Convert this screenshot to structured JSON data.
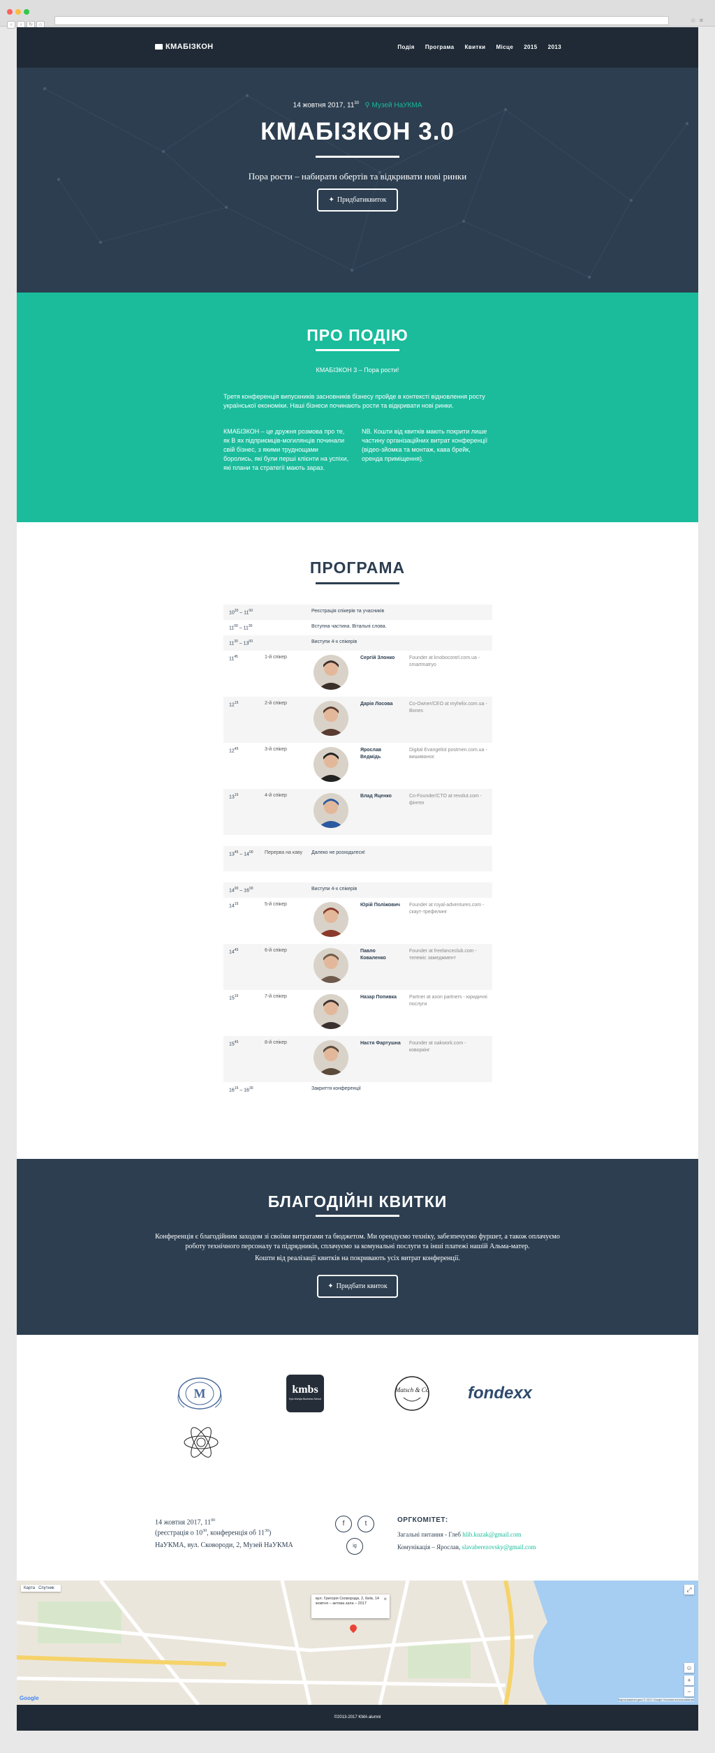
{
  "nav": {
    "brand": "КМАБІЗКОН",
    "links": [
      "Подія",
      "Програма",
      "Квитки",
      "Місце",
      "2015",
      "2013"
    ]
  },
  "hero": {
    "date": "14 жовтня 2017, 11",
    "date_sup": "30",
    "location": "Музей НаУКМА",
    "title": "КМАБІЗКОН 3.0",
    "subtitle": "Пора рости – набирати обертів та відкривати нові ринки",
    "button": "Придбатиквиток"
  },
  "about": {
    "title": "ПРО ПОДІЮ",
    "lead": "КМАБІЗКОН 3 – Пора рости!",
    "p1": "Третя конференція випускників засновників бізнесу пройде в контексті відновлення росту української економіки. Наші бізнеси починають рости та відкривати нові ринки.",
    "col1": "КМАБІЗКОН – це дружня розмова про те, як В ях підприємців-могилянців починали свій бізнес, з якими труднощами боролись, які були перші клієнти на успіхи, які плани та стратегії мають зараз.",
    "col2": "NB. Кошти від квитків мають покрити лише частину організаційних витрат конференції (відео-зйомка та монтаж, кава брейк, оренда приміщення)."
  },
  "program": {
    "title": "ПРОГРАМА",
    "rows": [
      {
        "time": "10",
        "tsup": "30",
        "time2": " – 11",
        "tsup2": "00",
        "slot": "",
        "event": "Реєстрація спікерів та учасників",
        "name": "",
        "role": "",
        "shade": true,
        "photo": false
      },
      {
        "time": "11",
        "tsup": "00",
        "time2": " – 11",
        "tsup2": "30",
        "slot": "",
        "event": "Вступна частина. Вітальні слова.",
        "name": "",
        "role": "",
        "shade": false,
        "photo": false
      },
      {
        "time": "11",
        "tsup": "30",
        "time2": " – 13",
        "tsup2": "00",
        "slot": "",
        "event": "Виступи 4-х спікерів",
        "name": "",
        "role": "",
        "shade": true,
        "photo": false
      },
      {
        "time": "11",
        "tsup": "45",
        "time2": "",
        "tsup2": "",
        "slot": "1-й спікер",
        "event": "",
        "name": "Сергій Злонко",
        "role": "Founder at knobocontrl.com.ua - smartmatryo",
        "shade": false,
        "photo": true
      },
      {
        "time": "12",
        "tsup": "15",
        "time2": "",
        "tsup2": "",
        "slot": "2-й спікер",
        "event": "",
        "name": "Дарія Лосова",
        "role": "Co-Owner/CEO at myhelix.com.ua - Bones",
        "shade": true,
        "photo": true
      },
      {
        "time": "12",
        "tsup": "45",
        "time2": "",
        "tsup2": "",
        "slot": "3-й спікер",
        "event": "",
        "name": "Ярослав Ведмідь",
        "role": "Digital Evangelist postmen.com.ua - вишиваноє",
        "shade": false,
        "photo": true
      },
      {
        "time": "13",
        "tsup": "15",
        "time2": "",
        "tsup2": "",
        "slot": "4-й спікер",
        "event": "",
        "name": "Влад Яценко",
        "role": "Co-Founder/CTO at revolut.com - фінтех",
        "shade": true,
        "photo": true
      },
      {
        "time": "13",
        "tsup": "45",
        "time2": " – 14",
        "tsup2": "00",
        "slot": "Перерва на каву",
        "event": "Далеко не розходьтеся!",
        "name": "",
        "role": "",
        "shade": true,
        "photo": false
      },
      {
        "time": "14",
        "tsup": "00",
        "time2": " – 16",
        "tsup2": "00",
        "slot": "",
        "event": "Виступи 4-х спікерів",
        "name": "",
        "role": "",
        "shade": true,
        "photo": false
      },
      {
        "time": "14",
        "tsup": "15",
        "time2": "",
        "tsup2": "",
        "slot": "5-й спікер",
        "event": "",
        "name": "Юрій Поліжович",
        "role": "Founder at royal-adventures.com - скаут-трефелинг",
        "shade": false,
        "photo": true
      },
      {
        "time": "14",
        "tsup": "45",
        "time2": "",
        "tsup2": "",
        "slot": "6-й спікер",
        "event": "",
        "name": "Павло Коваленко",
        "role": "Founder at freelanceclub.com - телеміс замеджмент",
        "shade": true,
        "photo": true
      },
      {
        "time": "15",
        "tsup": "15",
        "time2": "",
        "tsup2": "",
        "slot": "7-й спікер",
        "event": "",
        "name": "Назар Попивка",
        "role": "Partner at axon partners - юридичні послуги",
        "shade": false,
        "photo": true
      },
      {
        "time": "15",
        "tsup": "45",
        "time2": "",
        "tsup2": "",
        "slot": "8-й спікер",
        "event": "",
        "name": "Настя Фартушна",
        "role": "Founder at oakwork.com - коворкінг",
        "shade": true,
        "photo": true
      },
      {
        "time": "16",
        "tsup": "15",
        "time2": " – 16",
        "tsup2": "30",
        "slot": "",
        "event": "Закриття конференції",
        "name": "",
        "role": "",
        "shade": false,
        "photo": false
      }
    ]
  },
  "charity": {
    "title": "БЛАГОДІЙНІ КВИТКИ",
    "text": "Конференція є благодійним заходом зі своїми витратами та бюджетом. Ми орендуємо техніку, забезпечуємо фуршет, а також оплачуємо роботу технічного персоналу та підрядників, сплачуємо за комунальні послуги та інші платежі нашій Альма-матер.",
    "text2": "Кошти від реалізації квитків на покривають усіх витрат конференції.",
    "button": "Придбати квиток"
  },
  "sponsors": {
    "kmbs_label": "kmbs",
    "kmbs_small": "Kyiv-Mohyla Business School",
    "matsch": "Matsch & Co",
    "fondexx": "fondexx"
  },
  "footer": {
    "line1": "14 жовтня 2017, 11",
    "line1_sup": "00",
    "line2a": "(реєстрація о 10",
    "line2_sup": "30",
    "line2b": ", конференція об 11",
    "line2_sup2": "30",
    "line2c": ")",
    "address": "НаУКМА, вул. Сковороди, 2, Музей НаУКМА",
    "org_title": "ОРГКОМІТЕТ:",
    "org1_label": "Загальні питання - Глеб",
    "org1_mail": "hlib.kuzak@gmail.com",
    "org2_label": "Комунікація – Ярослав,",
    "org2_mail": "slavaberezovsky@gmail.com",
    "social": [
      "f",
      "t",
      "ig"
    ]
  },
  "map": {
    "tab_map": "Карта",
    "tab_sat": "Спутник",
    "info": "вул. Григорія Сковороди, 2, Київ, 14 жовтня – актова зала – 2017",
    "terms": "Картографічні дані © 2017 Google  Условия использования",
    "google": "Google"
  },
  "copyright": "©2013-2017 KMA alumni",
  "colors": {
    "navy": "#2c3e50",
    "teal": "#1abc9c",
    "dark": "#1f2a36"
  }
}
